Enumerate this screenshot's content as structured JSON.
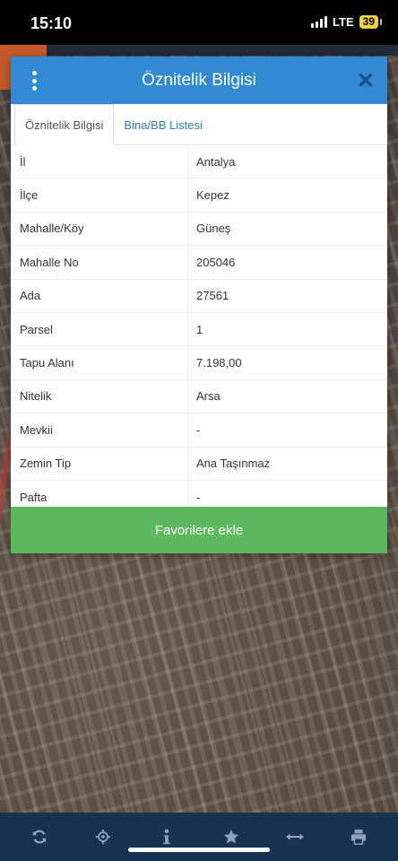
{
  "status": {
    "time": "15:10",
    "network": "LTE",
    "battery": "39"
  },
  "modal": {
    "title": "Öznitelik Bilgisi",
    "tabs": [
      {
        "label": "Öznitelik Bilgisi",
        "active": true
      },
      {
        "label": "Bina/BB Listesi",
        "active": false
      }
    ],
    "rows": [
      {
        "key": "İl",
        "value": "Antalya"
      },
      {
        "key": "İlçe",
        "value": "Kepez"
      },
      {
        "key": "Mahalle/Köy",
        "value": "Güneş"
      },
      {
        "key": "Mahalle No",
        "value": "205046"
      },
      {
        "key": "Ada",
        "value": "27561"
      },
      {
        "key": "Parsel",
        "value": "1"
      },
      {
        "key": "Tapu Alanı",
        "value": "7.198,00"
      },
      {
        "key": "Nitelik",
        "value": "Arsa"
      },
      {
        "key": "Mevkii",
        "value": "-"
      },
      {
        "key": "Zemin Tip",
        "value": "Ana Taşınmaz"
      },
      {
        "key": "Pafta",
        "value": "-"
      }
    ],
    "favorite_label": "Favorilere ekle"
  },
  "toolbar": {
    "icons": [
      "refresh-icon",
      "locate-icon",
      "info-icon",
      "star-icon",
      "measure-icon",
      "print-icon"
    ]
  },
  "colors": {
    "header": "#3189d3",
    "favorite": "#5cb85c",
    "toolbar": "#173252",
    "icon": "#8fa3bd"
  }
}
